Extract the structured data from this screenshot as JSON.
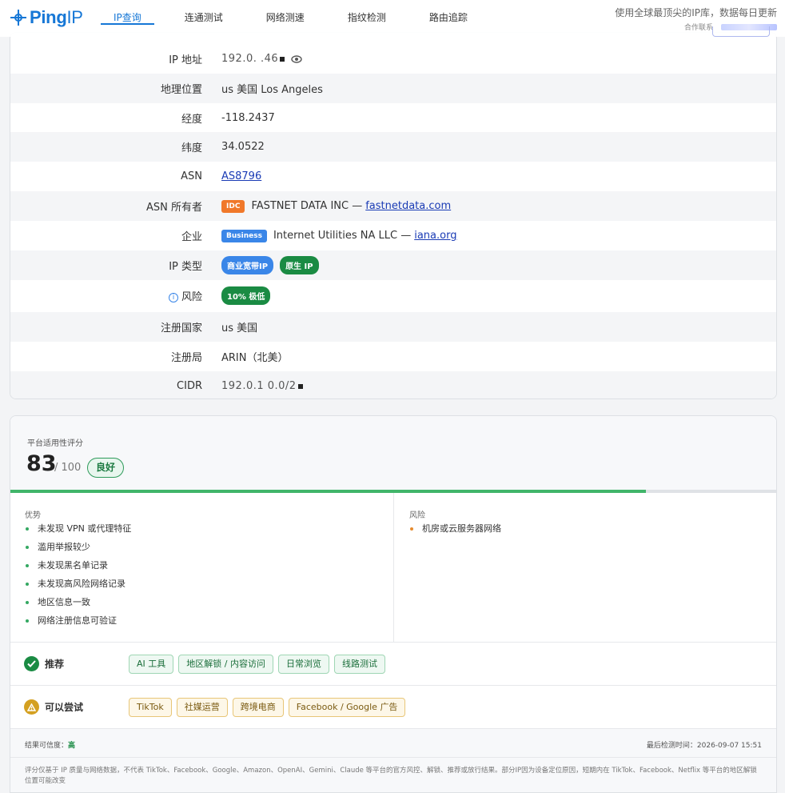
{
  "header": {
    "logo_text": "Ping",
    "logo_suffix": "IP",
    "nav": [
      "IP查询",
      "连通测试",
      "网络测速",
      "指纹检测",
      "路由追踪"
    ],
    "slogan": "使用全球最顶尖的IP库，数据每日更新",
    "contact": "合作联系"
  },
  "info": {
    "rows": [
      {
        "label": "IP 地址",
        "value": "192.0.  .46"
      },
      {
        "label": "地理位置",
        "value": "us 美国 Los Angeles"
      },
      {
        "label": "经度",
        "value": "-118.2437"
      },
      {
        "label": "纬度",
        "value": "34.0522"
      },
      {
        "label": "ASN",
        "value": "AS8796"
      },
      {
        "label": "ASN 所有者",
        "tag": "IDC",
        "value": "FASTNET DATA INC —",
        "link": "fastnetdata.com"
      },
      {
        "label": "企业",
        "tag": "Business",
        "value": "Internet Utilities NA LLC —",
        "link": "iana.org"
      },
      {
        "label": "IP 类型",
        "pills": [
          "商业宽带IP",
          "原生 IP"
        ]
      },
      {
        "label": "风险",
        "pill": "10% 极低"
      },
      {
        "label": "注册国家",
        "value": "us 美国"
      },
      {
        "label": "注册局",
        "value": "ARIN（北美）"
      },
      {
        "label": "CIDR",
        "value": "192.0.1  0.0/2"
      }
    ]
  },
  "score": {
    "title": "平台适用性评分",
    "value": "83",
    "max": "/ 100",
    "rating": "良好",
    "fill_percent": 83,
    "pros_title": "优势",
    "pros": [
      "未发现 VPN 或代理特征",
      "滥用举报较少",
      "未发现黑名单记录",
      "未发现高风险网络记录",
      "地区信息一致",
      "网络注册信息可验证"
    ],
    "cons_title": "风险",
    "cons": [
      "机房或云服务器网络"
    ],
    "recommend_label": "推荐",
    "recommend": [
      "AI 工具",
      "地区解锁 / 内容访问",
      "日常浏览",
      "线路测试"
    ],
    "try_label": "可以尝试",
    "try": [
      "TikTok",
      "社媒运营",
      "跨境电商",
      "Facebook / Google 广告"
    ],
    "confidence_label": "结果可信度：",
    "confidence": "高",
    "checked_time": "最后检测时间：2026-09-07 15:51",
    "disclaimer": "评分仅基于 IP 质量与网络数据，不代表 TikTok、Facebook、Google、Amazon、OpenAI、Gemini、Claude 等平台的官方风控、解锁、推荐或放行结果。部分IP因为设备定位原因，短期内在 TikTok、Facebook、Netflix 等平台的地区解锁位置可能改变"
  }
}
